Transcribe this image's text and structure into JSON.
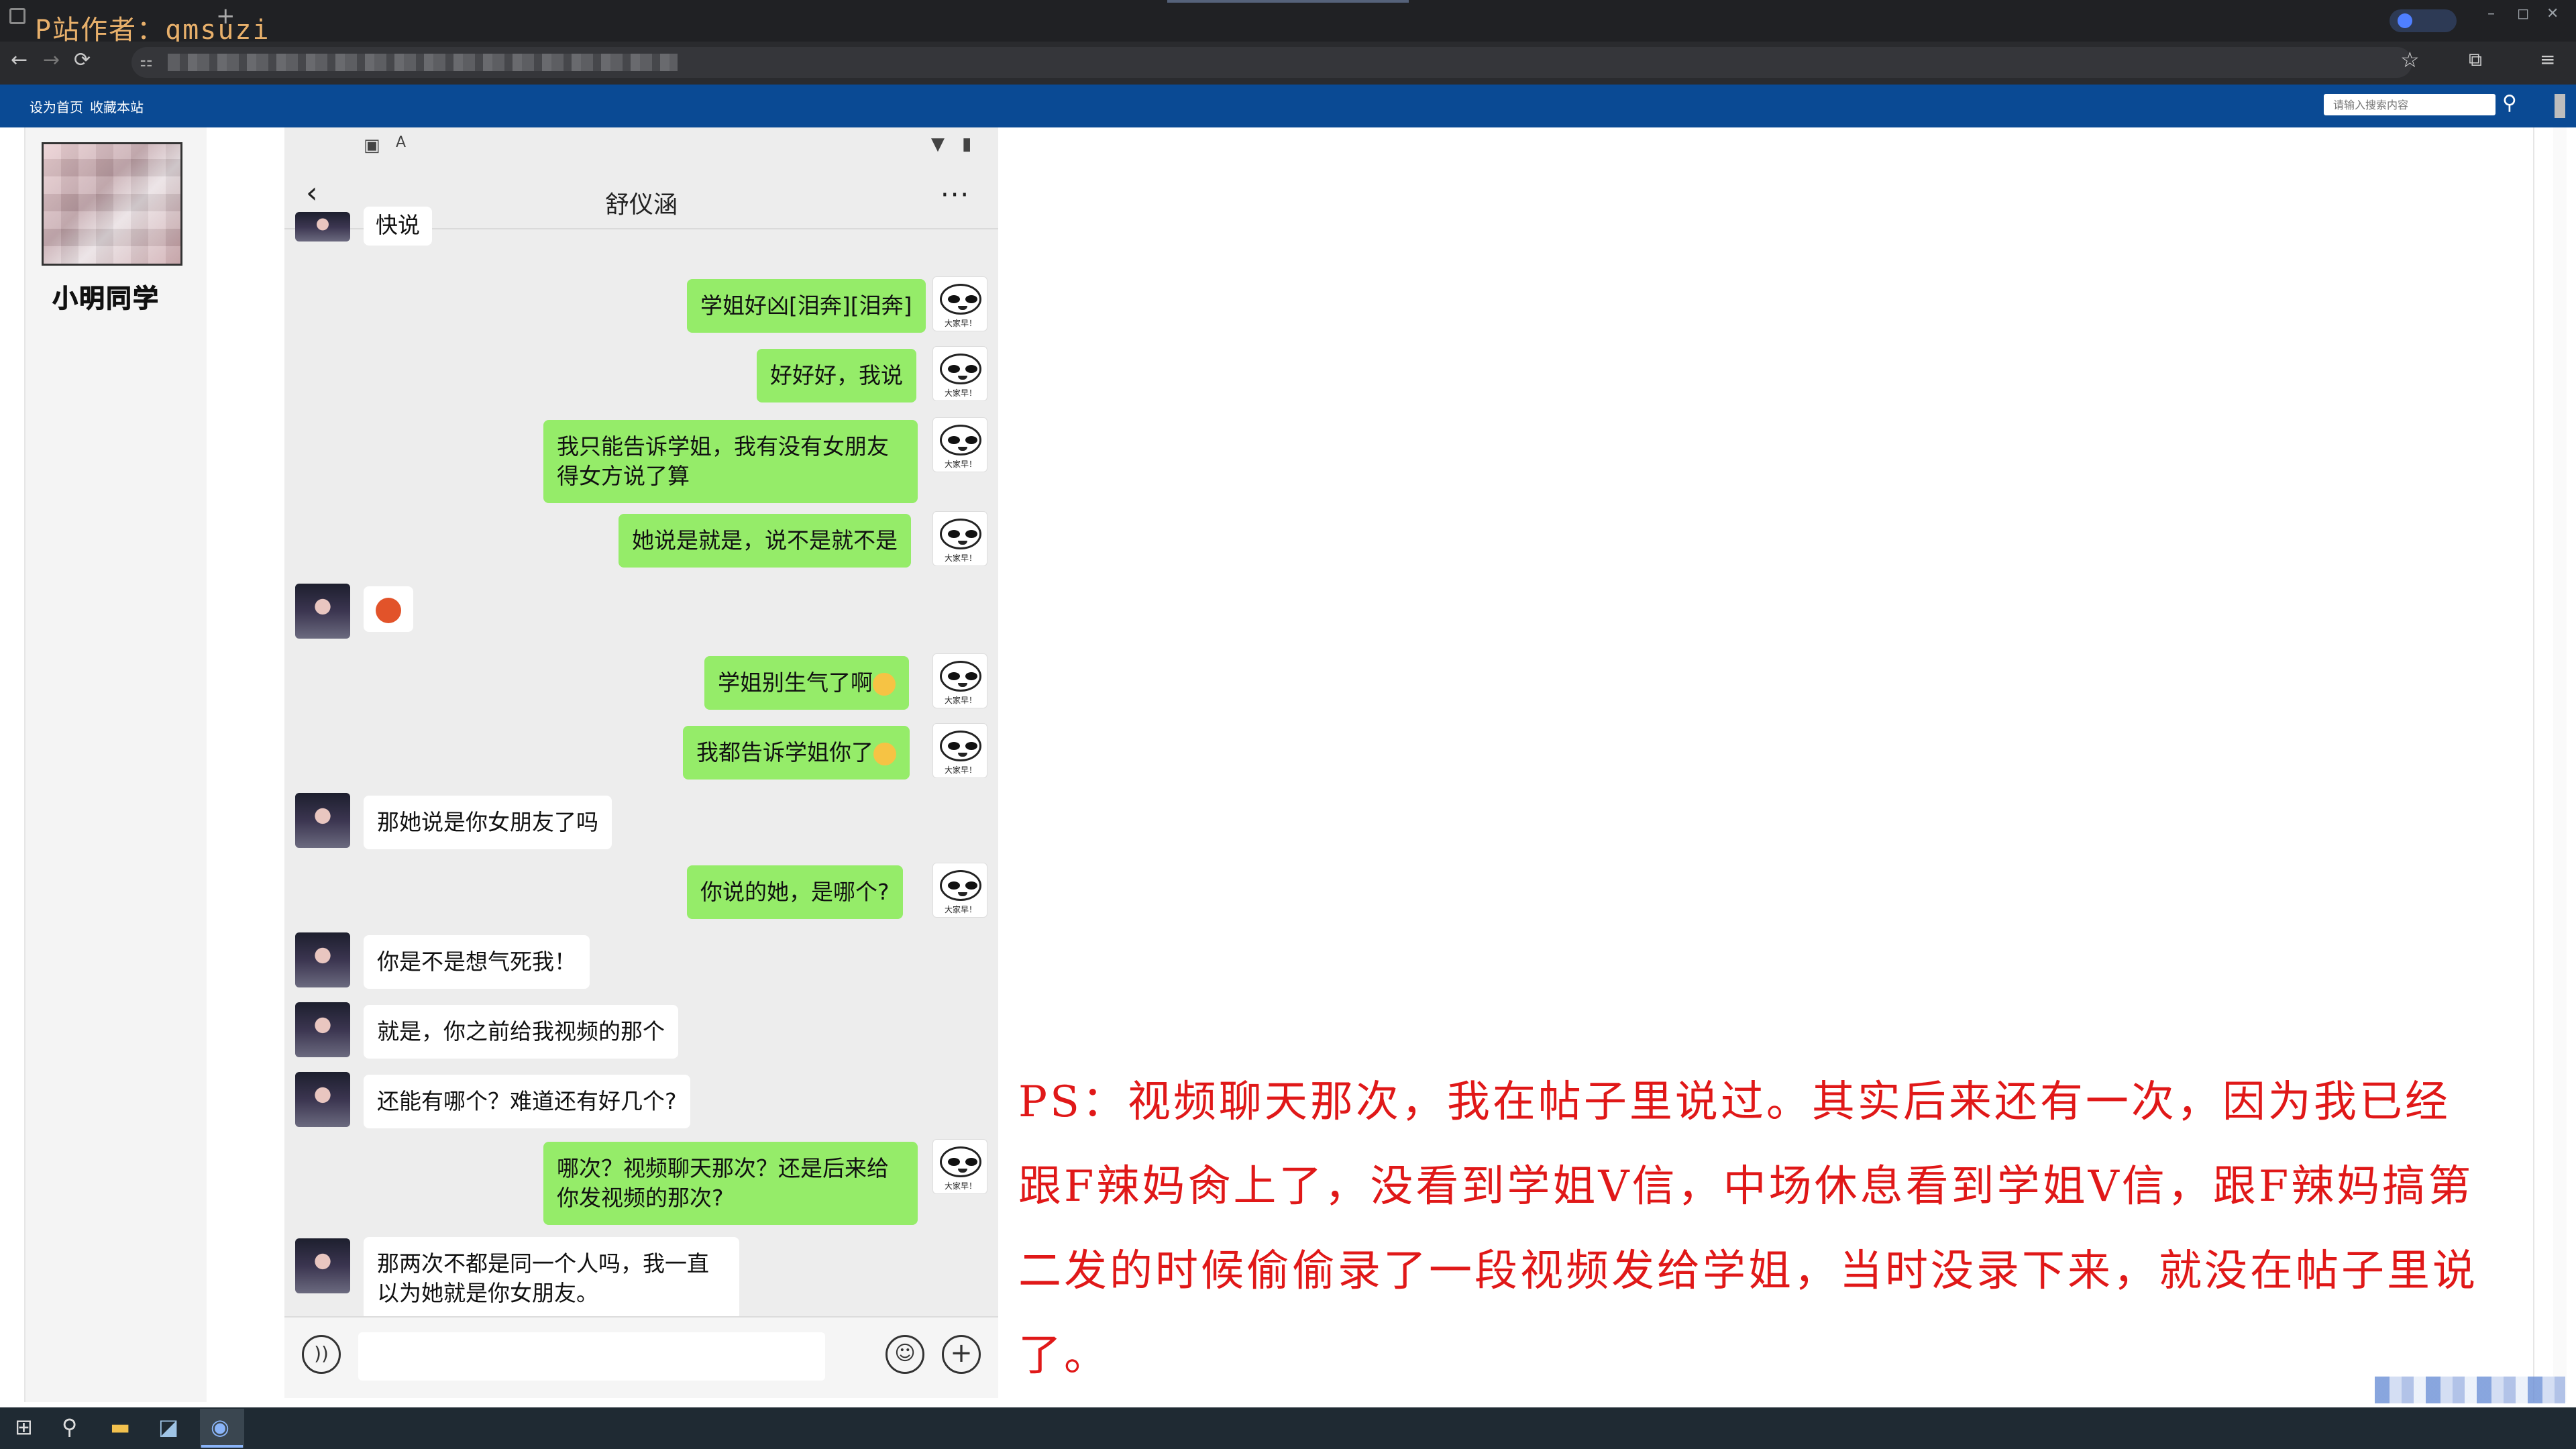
{
  "watermark": "P站作者：qmsuzi",
  "window": {
    "minimize": "–",
    "maximize": "◻",
    "close": "✕"
  },
  "browser": {
    "back": "←",
    "forward": "→",
    "reload": "⟳",
    "bookmark_star": "☆",
    "extensions": "⧉",
    "menu": "≡"
  },
  "site": {
    "set_home": "设为首页",
    "bookmark_site": "收藏本站",
    "search_placeholder": "请输入搜索内容"
  },
  "profile": {
    "username": "小明同学"
  },
  "phone": {
    "chat_title": "舒仪涵",
    "back": "‹",
    "more": "···",
    "messages": [
      {
        "side": "in",
        "text": "快说"
      },
      {
        "side": "out",
        "text": "学姐好凶[泪奔][泪奔]"
      },
      {
        "side": "out",
        "text": "好好好，我说"
      },
      {
        "side": "out",
        "text": "我只能告诉学姐，我有没有女朋友得女方说了算"
      },
      {
        "side": "out",
        "text": "她说是就是，说不是就不是"
      },
      {
        "side": "in",
        "text": ""
      },
      {
        "side": "out",
        "text": "学姐别生气了啊"
      },
      {
        "side": "out",
        "text": "我都告诉学姐你了"
      },
      {
        "side": "in",
        "text": "那她说是你女朋友了吗"
      },
      {
        "side": "out",
        "text": "你说的她，是哪个?"
      },
      {
        "side": "in",
        "text": "你是不是想气死我！"
      },
      {
        "side": "in",
        "text": "就是，你之前给我视频的那个"
      },
      {
        "side": "in",
        "text": "还能有哪个？难道还有好几个?"
      },
      {
        "side": "out",
        "text": "哪次？视频聊天那次？还是后来给你发视频的那次?"
      },
      {
        "side": "in",
        "text": "那两次不都是同一个人吗，我一直以为她就是你女朋友。"
      }
    ],
    "sticker_caption": "大家早！"
  },
  "annotation": "PS：视频聊天那次，我在帖子里说过。其实后来还有一次，因为我已经跟F辣妈肏上了，没看到学姐V信，中场休息看到学姐V信，跟F辣妈搞第二发的时候偷偷录了一段视频发给学姐，当时没录下来，就没在帖子里说了。",
  "colors": {
    "site_header": "#0a4a94",
    "outgoing_bubble": "#95ec69",
    "incoming_bubble": "#ffffff",
    "annotation": "#e01818"
  }
}
